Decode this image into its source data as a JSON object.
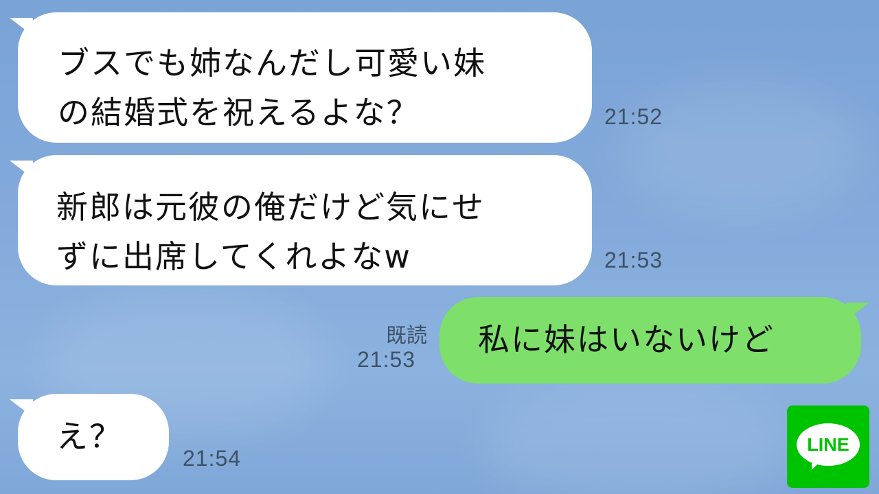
{
  "messages": [
    {
      "side": "received",
      "lines": [
        "ブスでも姉なんだし可愛い妹",
        "の結婚式を祝えるよな？"
      ],
      "time": "21:52"
    },
    {
      "side": "received",
      "lines": [
        "新郎は元彼の俺だけど気にせ",
        "ずに出席してくれよなw"
      ],
      "time": "21:53"
    },
    {
      "side": "sent",
      "lines": [
        "私に妹はいないけど"
      ],
      "read_label": "既読",
      "time": "21:53"
    },
    {
      "side": "received",
      "lines": [
        "え？"
      ],
      "time": "21:54"
    }
  ],
  "logo": {
    "text": "LINE",
    "color": "#00c300"
  },
  "colors": {
    "background": "#82a9da",
    "received_bubble": "#ffffff",
    "sent_bubble": "#7ee06b"
  }
}
